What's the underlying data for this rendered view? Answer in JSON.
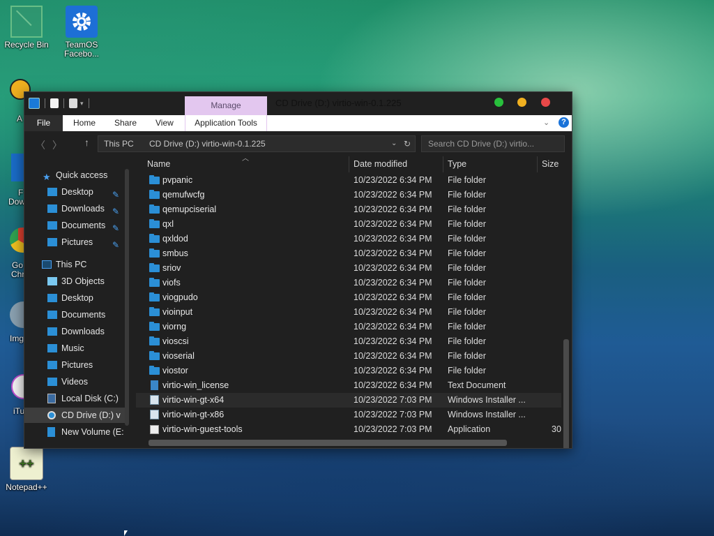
{
  "desktop": {
    "icons": [
      {
        "label": "Recycle Bin",
        "icon": "recycle-bin-icon"
      },
      {
        "label": "TeamOS Facebo...",
        "icon": "gear-icon"
      },
      {
        "label": "Notepad++",
        "icon": "notepad-plus-plus-icon"
      }
    ],
    "partial_labels": [
      "A",
      "F",
      "Dow",
      "Go",
      "Chr",
      "Img",
      "iTu"
    ]
  },
  "window": {
    "title": "CD Drive (D:) virtio-win-0.1.225",
    "context_tab": "Manage",
    "ribbon_tabs": [
      "File",
      "Home",
      "Share",
      "View",
      "Application Tools"
    ],
    "address_segments": [
      "This PC",
      "CD Drive (D:) virtio-win-0.1.225"
    ],
    "search_placeholder": "Search CD Drive (D:) virtio...",
    "colors": {
      "close": "#e84848",
      "minimize": "#f0b020",
      "maximize": "#28c03c",
      "manage_tab": "#e3c7ef",
      "folder": "#2b8fd6"
    }
  },
  "nav": {
    "quick_access": "Quick access",
    "quick_items": [
      "Desktop",
      "Downloads",
      "Documents",
      "Pictures"
    ],
    "this_pc": "This PC",
    "pc_items": [
      "3D Objects",
      "Desktop",
      "Documents",
      "Downloads",
      "Music",
      "Pictures",
      "Videos",
      "Local Disk (C:)",
      "CD Drive (D:) v",
      "New Volume (E:"
    ]
  },
  "columns": [
    "Name",
    "Date modified",
    "Type",
    "Size"
  ],
  "files": [
    {
      "name": "pvpanic",
      "date": "10/23/2022 6:34 PM",
      "type": "File folder",
      "size": "",
      "icon": "folder-icon"
    },
    {
      "name": "qemufwcfg",
      "date": "10/23/2022 6:34 PM",
      "type": "File folder",
      "size": "",
      "icon": "folder-icon"
    },
    {
      "name": "qemupciserial",
      "date": "10/23/2022 6:34 PM",
      "type": "File folder",
      "size": "",
      "icon": "folder-icon"
    },
    {
      "name": "qxl",
      "date": "10/23/2022 6:34 PM",
      "type": "File folder",
      "size": "",
      "icon": "folder-icon"
    },
    {
      "name": "qxldod",
      "date": "10/23/2022 6:34 PM",
      "type": "File folder",
      "size": "",
      "icon": "folder-icon"
    },
    {
      "name": "smbus",
      "date": "10/23/2022 6:34 PM",
      "type": "File folder",
      "size": "",
      "icon": "folder-icon"
    },
    {
      "name": "sriov",
      "date": "10/23/2022 6:34 PM",
      "type": "File folder",
      "size": "",
      "icon": "folder-icon"
    },
    {
      "name": "viofs",
      "date": "10/23/2022 6:34 PM",
      "type": "File folder",
      "size": "",
      "icon": "folder-icon"
    },
    {
      "name": "viogpudo",
      "date": "10/23/2022 6:34 PM",
      "type": "File folder",
      "size": "",
      "icon": "folder-icon"
    },
    {
      "name": "vioinput",
      "date": "10/23/2022 6:34 PM",
      "type": "File folder",
      "size": "",
      "icon": "folder-icon"
    },
    {
      "name": "viorng",
      "date": "10/23/2022 6:34 PM",
      "type": "File folder",
      "size": "",
      "icon": "folder-icon"
    },
    {
      "name": "vioscsi",
      "date": "10/23/2022 6:34 PM",
      "type": "File folder",
      "size": "",
      "icon": "folder-icon"
    },
    {
      "name": "vioserial",
      "date": "10/23/2022 6:34 PM",
      "type": "File folder",
      "size": "",
      "icon": "folder-icon"
    },
    {
      "name": "viostor",
      "date": "10/23/2022 6:34 PM",
      "type": "File folder",
      "size": "",
      "icon": "folder-icon"
    },
    {
      "name": "virtio-win_license",
      "date": "10/23/2022 6:34 PM",
      "type": "Text Document",
      "size": "",
      "icon": "text-document-icon"
    },
    {
      "name": "virtio-win-gt-x64",
      "date": "10/23/2022 7:03 PM",
      "type": "Windows Installer ...",
      "size": "",
      "icon": "installer-icon"
    },
    {
      "name": "virtio-win-gt-x86",
      "date": "10/23/2022 7:03 PM",
      "type": "Windows Installer ...",
      "size": "",
      "icon": "installer-icon"
    },
    {
      "name": "virtio-win-guest-tools",
      "date": "10/23/2022 7:03 PM",
      "type": "Application",
      "size": "30",
      "icon": "application-icon"
    }
  ]
}
